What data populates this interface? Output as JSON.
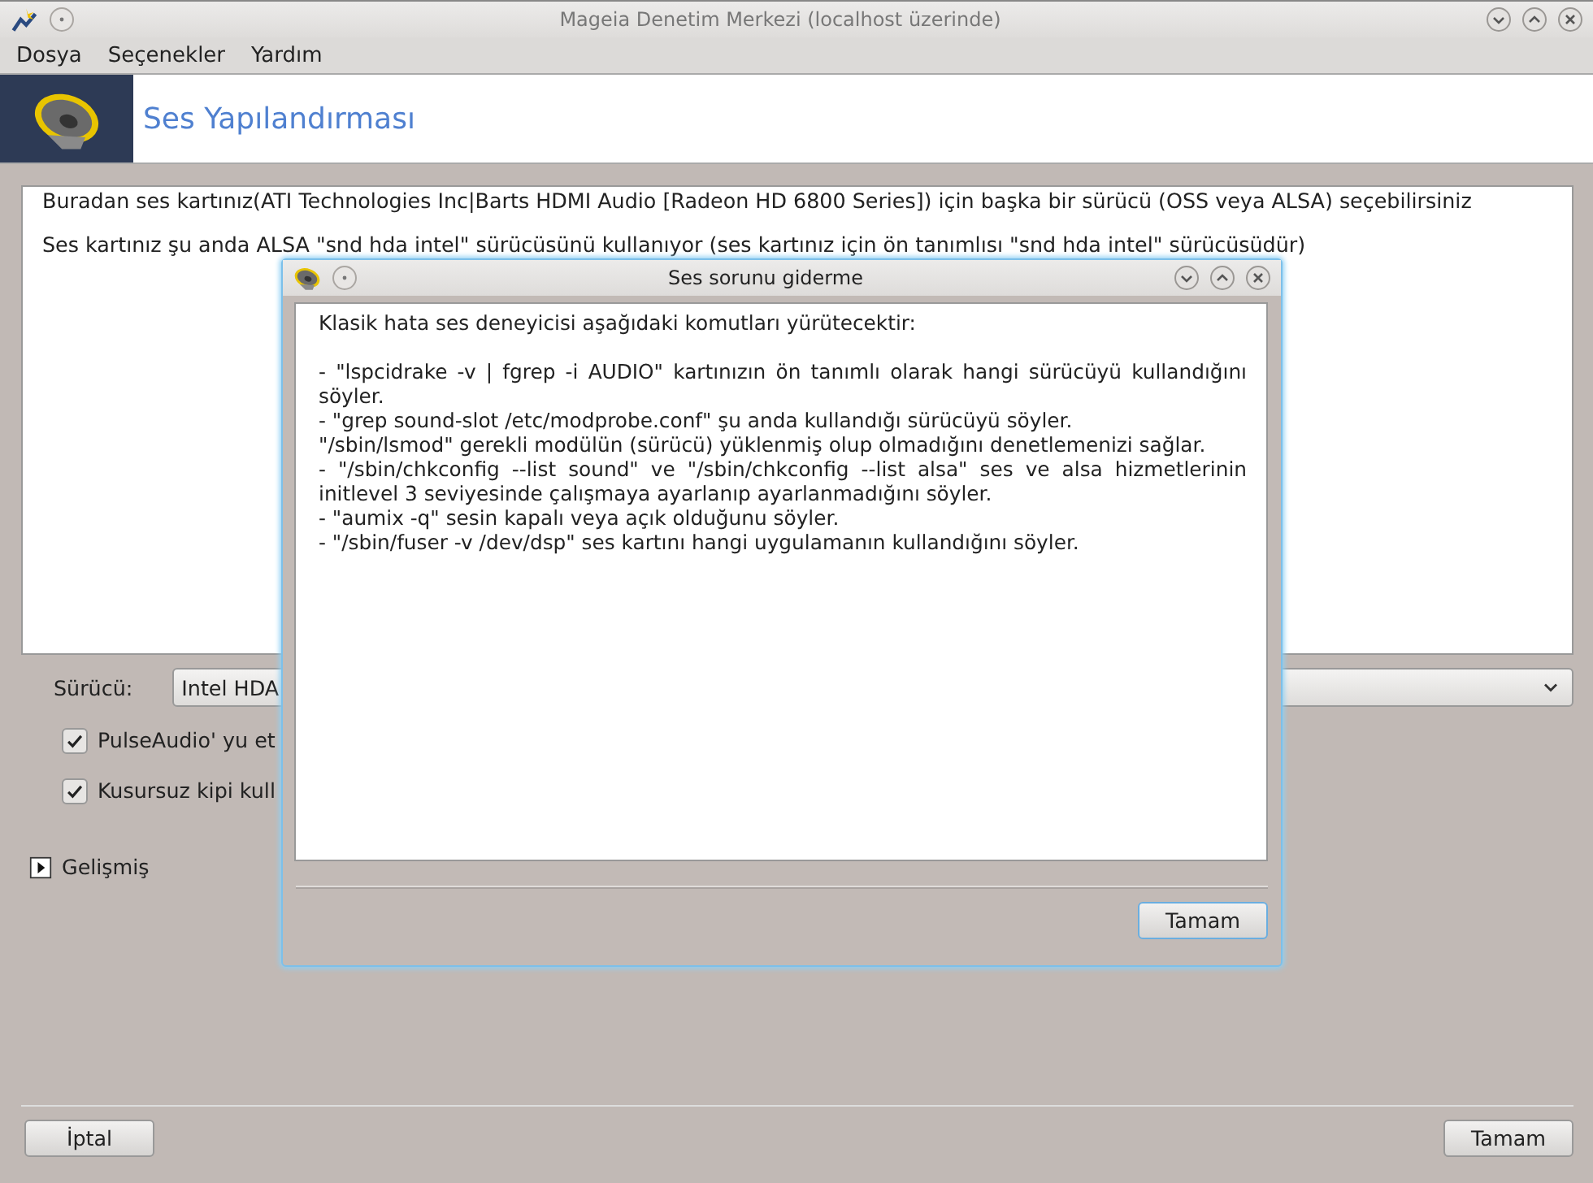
{
  "window": {
    "title": "Mageia Denetim Merkezi  (localhost üzerinde)"
  },
  "menu": [
    "Dosya",
    "Seçenekler",
    "Yardım"
  ],
  "header": {
    "title": "Ses Yapılandırması"
  },
  "info": [
    "Buradan ses kartınız(ATI Technologies Inc|Barts HDMI Audio [Radeon HD 6800 Series]) için başka bir sürücü (OSS veya ALSA) seçebilirsiniz",
    "Ses kartınız şu anda ALSA \"snd hda intel\" sürücüsünü kullanıyor (ses kartınız için ön tanımlısı \"snd hda intel\" sürücüsüdür)"
  ],
  "driver": {
    "label": "Sürücü:",
    "value": "Intel HDA"
  },
  "options": [
    {
      "label": "PulseAudio' yu et",
      "checked": true
    },
    {
      "label": "Kusursuz kipi kull",
      "checked": true
    }
  ],
  "advanced": {
    "label": "Gelişmiş",
    "expanded": false
  },
  "buttons": {
    "cancel": "İptal",
    "ok": "Tamam"
  },
  "dialog": {
    "title": "Ses sorunu giderme",
    "intro": "Klasik hata ses deneyicisi aşağıdaki komutları yürütecektir:",
    "lines": [
      "- \"lspcidrake -v | fgrep -i AUDIO\" kartınızın ön tanımlı olarak hangi sürücüyü  kullandığını söyler.",
      "- \"grep sound-slot /etc/modprobe.conf\" şu anda kullandığı sürücüyü söyler.",
      "\"/sbin/lsmod\" gerekli modülün (sürücü) yüklenmiş olup olmadığını denetlemenizi sağlar.",
      "- \"/sbin/chkconfig --list sound\" ve \"/sbin/chkconfig --list alsa\" ses ve alsa hizmetlerinin initlevel 3 seviyesinde çalışmaya ayarlanıp ayarlanmadığını söyler.",
      "- \"aumix -q\" sesin kapalı veya açık olduğunu söyler.",
      "- \"/sbin/fuser -v /dev/dsp\" ses kartını hangi uygulamanın kullandığını söyler."
    ],
    "button": "Tamam"
  }
}
